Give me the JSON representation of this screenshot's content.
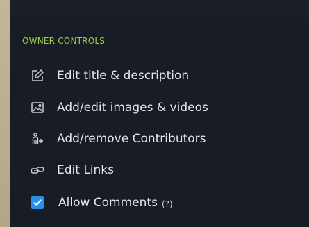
{
  "section": {
    "title": "OWNER CONTROLS"
  },
  "items": [
    {
      "label": "Edit title & description",
      "icon": "pencil-edit-icon"
    },
    {
      "label": "Add/edit images & videos",
      "icon": "image-icon"
    },
    {
      "label": "Add/remove Contributors",
      "icon": "contributors-icon"
    },
    {
      "label": "Edit Links",
      "icon": "link-icon"
    }
  ],
  "allow_comments": {
    "label": "Allow Comments",
    "help": "(?)",
    "checked": true
  },
  "colors": {
    "panel_bg": "#171c25",
    "accent_green": "#9fd045",
    "checkbox_blue": "#2a8fe8",
    "text": "#e3e6ea"
  }
}
